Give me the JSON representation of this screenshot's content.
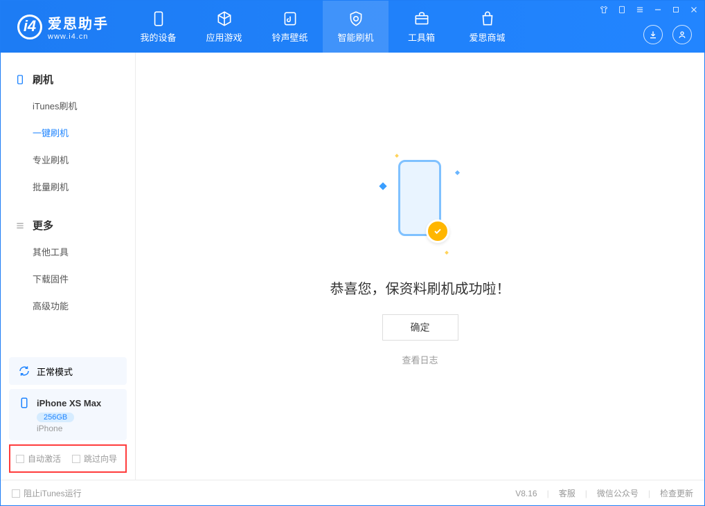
{
  "app": {
    "title": "爱思助手",
    "subtitle": "www.i4.cn"
  },
  "tabs": [
    {
      "label": "我的设备"
    },
    {
      "label": "应用游戏"
    },
    {
      "label": "铃声壁纸"
    },
    {
      "label": "智能刷机"
    },
    {
      "label": "工具箱"
    },
    {
      "label": "爱思商城"
    }
  ],
  "sidebar": {
    "group1": "刷机",
    "items1": [
      "iTunes刷机",
      "一键刷机",
      "专业刷机",
      "批量刷机"
    ],
    "group2": "更多",
    "items2": [
      "其他工具",
      "下载固件",
      "高级功能"
    ]
  },
  "mode": {
    "label": "正常模式"
  },
  "device": {
    "name": "iPhone XS Max",
    "storage": "256GB",
    "type": "iPhone"
  },
  "options": {
    "auto_activate": "自动激活",
    "skip_guide": "跳过向导"
  },
  "main": {
    "success": "恭喜您，保资料刷机成功啦！",
    "ok": "确定",
    "view_log": "查看日志"
  },
  "footer": {
    "block_itunes": "阻止iTunes运行",
    "version": "V8.16",
    "support": "客服",
    "wechat": "微信公众号",
    "update": "检查更新"
  }
}
